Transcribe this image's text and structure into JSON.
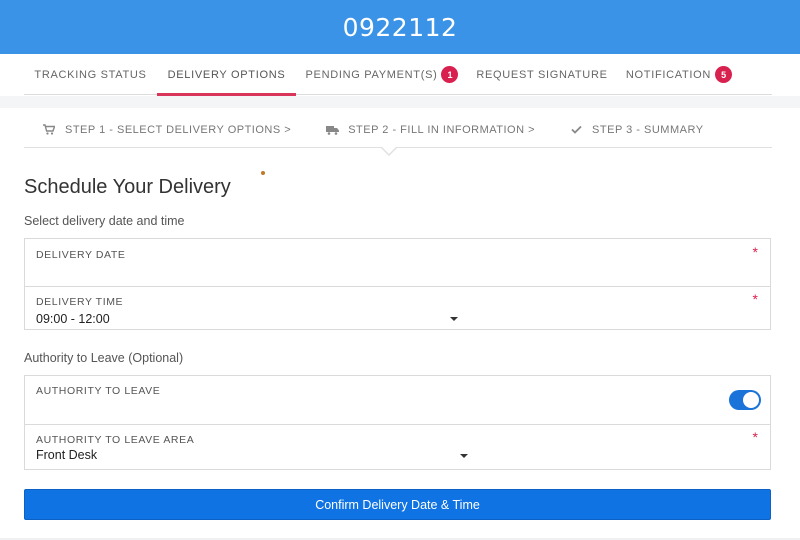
{
  "header": {
    "title": "0922112",
    "bg_color": "#3a93e6"
  },
  "tabs": [
    {
      "label": "TRACKING STATUS",
      "badge": ""
    },
    {
      "label": "DELIVERY OPTIONS",
      "badge": "",
      "active": true
    },
    {
      "label": "PENDING PAYMENT(S)",
      "badge": "1"
    },
    {
      "label": "REQUEST SIGNATURE",
      "badge": ""
    },
    {
      "label": "NOTIFICATION",
      "badge": "5"
    }
  ],
  "steps": [
    {
      "icon": "cart-icon",
      "label": "STEP 1 - SELECT DELIVERY OPTIONS >"
    },
    {
      "icon": "truck-icon",
      "label": "STEP 2 - FILL IN INFORMATION >"
    },
    {
      "icon": "check-icon",
      "label": "STEP 3 - SUMMARY"
    }
  ],
  "main": {
    "title": "Schedule Your Delivery",
    "date_time_section": "Select delivery date and time",
    "delivery_date": {
      "label": "DELIVERY DATE",
      "value": "",
      "required": "*"
    },
    "delivery_time": {
      "label": "DELIVERY TIME",
      "value": "09:00 - 12:00",
      "required": "*"
    },
    "authority_section": "Authority to Leave (Optional)",
    "authority_toggle": {
      "label": "AUTHORITY TO LEAVE",
      "on": true
    },
    "authority_area": {
      "label": "AUTHORITY TO LEAVE AREA",
      "value": "Front Desk",
      "required": "*"
    },
    "confirm_label": "Confirm Delivery Date & Time"
  },
  "colors": {
    "accent": "#d9355a",
    "badge": "#d9214f",
    "primary_button": "#0f73e3",
    "toggle_on": "#1a73d9"
  }
}
